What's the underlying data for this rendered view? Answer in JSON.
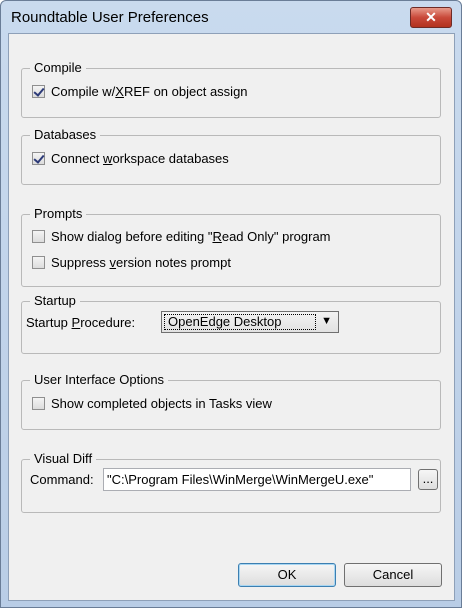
{
  "window": {
    "title": "Roundtable User Preferences",
    "close_label": "✕"
  },
  "compile": {
    "legend": "Compile",
    "option": {
      "pre": "Compile w/",
      "accel": "X",
      "post": "REF on object assign",
      "checked": true
    }
  },
  "databases": {
    "legend": "Databases",
    "option": {
      "pre": "Connect ",
      "accel": "w",
      "post": "orkspace databases",
      "checked": true
    }
  },
  "prompts": {
    "legend": "Prompts",
    "options": [
      {
        "pre": "Show dialog before editing \"",
        "accel": "R",
        "post": "ead Only\" program",
        "checked": false
      },
      {
        "pre": "Suppress ",
        "accel": "v",
        "post": "ersion notes prompt",
        "checked": false
      }
    ]
  },
  "startup": {
    "legend": "Startup",
    "label": {
      "pre": "Startup ",
      "accel": "P",
      "post": "rocedure:"
    },
    "value": "OpenEdge Desktop",
    "arrow_icon": "▼"
  },
  "ui_options": {
    "legend": "User Interface Options",
    "option": {
      "label": "Show completed objects in Tasks view",
      "checked": false
    }
  },
  "visual_diff": {
    "legend": "Visual Diff",
    "label": "Command:",
    "value": "\"C:\\Program Files\\WinMerge\\WinMergeU.exe\"",
    "browse_label": "..."
  },
  "buttons": {
    "ok": "OK",
    "cancel": "Cancel"
  }
}
